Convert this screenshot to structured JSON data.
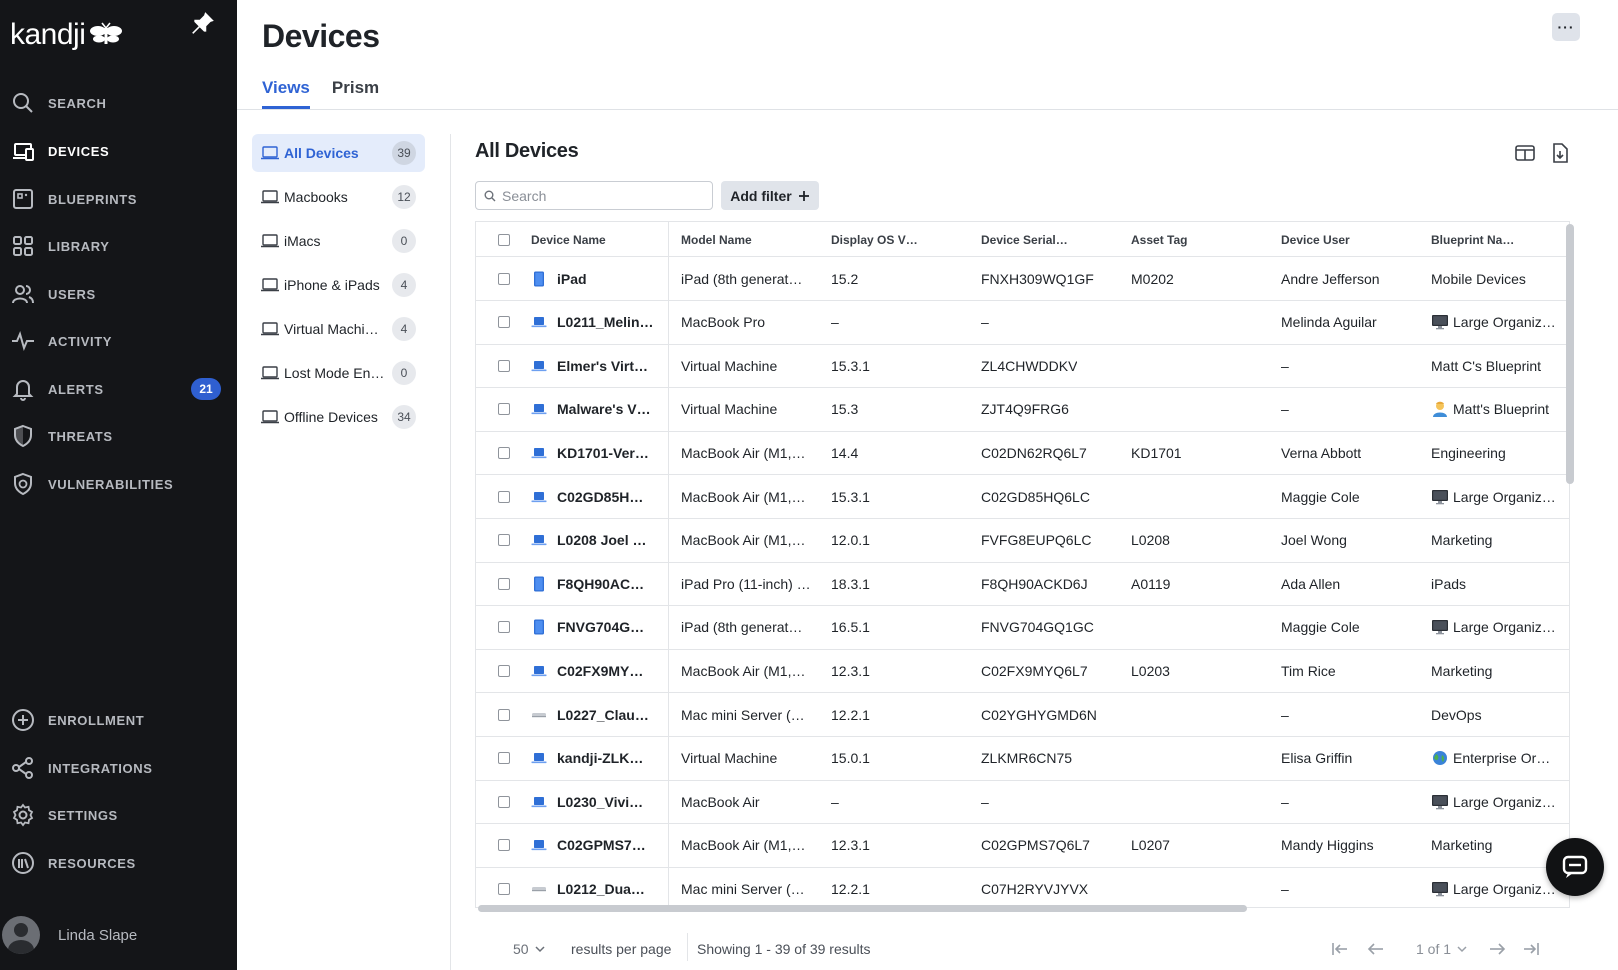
{
  "brand": {
    "name": "kandji"
  },
  "sidebar": {
    "top_items": [
      {
        "label": "SEARCH",
        "icon": "search-icon",
        "active": false
      },
      {
        "label": "DEVICES",
        "icon": "devices-icon",
        "active": true
      },
      {
        "label": "BLUEPRINTS",
        "icon": "blueprints-icon",
        "active": false
      },
      {
        "label": "LIBRARY",
        "icon": "library-icon",
        "active": false
      },
      {
        "label": "USERS",
        "icon": "users-icon",
        "active": false
      },
      {
        "label": "ACTIVITY",
        "icon": "activity-icon",
        "active": false
      },
      {
        "label": "ALERTS",
        "icon": "bell-icon",
        "active": false,
        "badge": "21"
      },
      {
        "label": "THREATS",
        "icon": "shield-icon",
        "active": false
      },
      {
        "label": "VULNERABILITIES",
        "icon": "vulnerability-icon",
        "active": false
      }
    ],
    "bottom_items": [
      {
        "label": "ENROLLMENT",
        "icon": "plus-circle-icon"
      },
      {
        "label": "INTEGRATIONS",
        "icon": "share-icon"
      },
      {
        "label": "SETTINGS",
        "icon": "gear-icon"
      },
      {
        "label": "RESOURCES",
        "icon": "resources-icon"
      }
    ],
    "user": {
      "name": "Linda Slape"
    }
  },
  "header": {
    "title": "Devices",
    "more_label": "···",
    "tabs": [
      {
        "label": "Views",
        "active": true
      },
      {
        "label": "Prism",
        "active": false
      }
    ]
  },
  "views": [
    {
      "label": "All Devices",
      "count": "39",
      "active": true
    },
    {
      "label": "Macbooks",
      "count": "12",
      "active": false
    },
    {
      "label": "iMacs",
      "count": "0",
      "active": false
    },
    {
      "label": "iPhone & iPads",
      "count": "4",
      "active": false
    },
    {
      "label": "Virtual Machi…",
      "count": "4",
      "active": false
    },
    {
      "label": "Lost Mode En…",
      "count": "0",
      "active": false
    },
    {
      "label": "Offline Devices",
      "count": "34",
      "active": false
    }
  ],
  "main": {
    "title": "All Devices",
    "search_placeholder": "Search",
    "add_filter_label": "Add filter"
  },
  "table": {
    "columns": [
      "Device Name",
      "Model Name",
      "Display OS V…",
      "Device Serial…",
      "Asset Tag",
      "Device User",
      "Blueprint Na…"
    ],
    "rows": [
      {
        "device_type": "ipad",
        "name": "iPad",
        "model": "iPad (8th generat…",
        "os": "15.2",
        "serial": "FNXH309WQ1GF",
        "asset": "M0202",
        "user": "Andre Jefferson",
        "blueprint_icon": "",
        "blueprint": "Mobile Devices"
      },
      {
        "device_type": "laptop",
        "name": "L0211_Melin…",
        "model": "MacBook Pro",
        "os": "–",
        "serial": "–",
        "asset": "",
        "user": "Melinda Aguilar",
        "blueprint_icon": "monitor",
        "blueprint": "Large Organiz…"
      },
      {
        "device_type": "laptop",
        "name": "Elmer's Virt…",
        "model": "Virtual Machine",
        "os": "15.3.1",
        "serial": "ZL4CHWDDKV",
        "asset": "",
        "user": "–",
        "blueprint_icon": "",
        "blueprint": "Matt C's Blueprint"
      },
      {
        "device_type": "laptop",
        "name": "Malware's V…",
        "model": "Virtual Machine",
        "os": "15.3",
        "serial": "ZJT4Q9FRG6",
        "asset": "",
        "user": "–",
        "blueprint_icon": "person",
        "blueprint": "Matt's Blueprint"
      },
      {
        "device_type": "laptop",
        "name": "KD1701-Ver…",
        "model": "MacBook Air (M1,…",
        "os": "14.4",
        "serial": "C02DN62RQ6L7",
        "asset": "KD1701",
        "user": "Verna Abbott",
        "blueprint_icon": "",
        "blueprint": "Engineering"
      },
      {
        "device_type": "laptop",
        "name": "C02GD85H…",
        "model": "MacBook Air (M1,…",
        "os": "15.3.1",
        "serial": "C02GD85HQ6LC",
        "asset": "",
        "user": "Maggie Cole",
        "blueprint_icon": "monitor",
        "blueprint": "Large Organiz…"
      },
      {
        "device_type": "laptop",
        "name": "L0208 Joel …",
        "model": "MacBook Air (M1,…",
        "os": "12.0.1",
        "serial": "FVFG8EUPQ6LC",
        "asset": "L0208",
        "user": "Joel Wong",
        "blueprint_icon": "",
        "blueprint": "Marketing"
      },
      {
        "device_type": "ipad",
        "name": "F8QH90AC…",
        "model": "iPad Pro (11-inch) …",
        "os": "18.3.1",
        "serial": "F8QH90ACKD6J",
        "asset": "A0119",
        "user": "Ada Allen",
        "blueprint_icon": "",
        "blueprint": "iPads"
      },
      {
        "device_type": "ipad",
        "name": "FNVG704G…",
        "model": "iPad (8th generat…",
        "os": "16.5.1",
        "serial": "FNVG704GQ1GC",
        "asset": "",
        "user": "Maggie Cole",
        "blueprint_icon": "monitor",
        "blueprint": "Large Organiz…"
      },
      {
        "device_type": "laptop",
        "name": "C02FX9MY…",
        "model": "MacBook Air (M1,…",
        "os": "12.3.1",
        "serial": "C02FX9MYQ6L7",
        "asset": "L0203",
        "user": "Tim Rice",
        "blueprint_icon": "",
        "blueprint": "Marketing"
      },
      {
        "device_type": "mini",
        "name": "L0227_Clau…",
        "model": "Mac mini Server (…",
        "os": "12.2.1",
        "serial": "C02YGHYGMD6N",
        "asset": "",
        "user": "–",
        "blueprint_icon": "",
        "blueprint": "DevOps"
      },
      {
        "device_type": "laptop",
        "name": "kandji-ZLK…",
        "model": "Virtual Machine",
        "os": "15.0.1",
        "serial": "ZLKMR6CN75",
        "asset": "",
        "user": "Elisa Griffin",
        "blueprint_icon": "globe",
        "blueprint": "Enterprise Or…"
      },
      {
        "device_type": "laptop",
        "name": "L0230_Vivi…",
        "model": "MacBook Air",
        "os": "–",
        "serial": "–",
        "asset": "",
        "user": "–",
        "blueprint_icon": "monitor",
        "blueprint": "Large Organiz…"
      },
      {
        "device_type": "laptop",
        "name": "C02GPMS7…",
        "model": "MacBook Air (M1,…",
        "os": "12.3.1",
        "serial": "C02GPMS7Q6L7",
        "asset": "L0207",
        "user": "Mandy Higgins",
        "blueprint_icon": "",
        "blueprint": "Marketing"
      },
      {
        "device_type": "mini",
        "name": "L0212_Dua…",
        "model": "Mac mini Server (…",
        "os": "12.2.1",
        "serial": "C07H2RYVJYVX",
        "asset": "",
        "user": "–",
        "blueprint_icon": "monitor",
        "blueprint": "Large Organiz…"
      }
    ]
  },
  "footer": {
    "per_page": "50",
    "per_page_label": "results per page",
    "showing": "Showing 1 - 39 of 39 results",
    "page_of": "1 of 1"
  },
  "colors": {
    "accent": "#2f63d4",
    "sidebar_bg": "#141518",
    "badge": "#2f5fd0"
  }
}
